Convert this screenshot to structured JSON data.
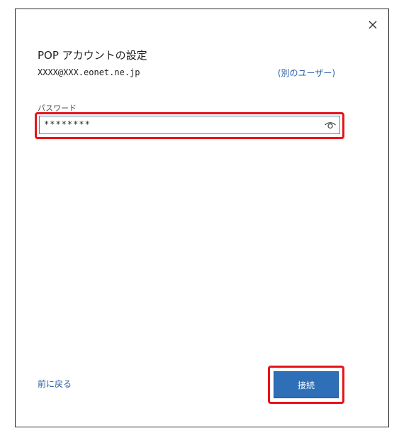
{
  "dialog": {
    "title": "POP アカウントの設定",
    "email": "XXXX@XXX.eonet.ne.jp",
    "alt_user_link": "(別のユーザー)",
    "close_icon": "close-icon"
  },
  "password": {
    "label": "パスワード",
    "value": "********",
    "reveal_icon": "eye-icon"
  },
  "footer": {
    "back_label": "前に戻る",
    "connect_label": "接続"
  },
  "colors": {
    "accent": "#2e6fb7",
    "highlight": "#e8141b",
    "link": "#2a5fa6"
  }
}
